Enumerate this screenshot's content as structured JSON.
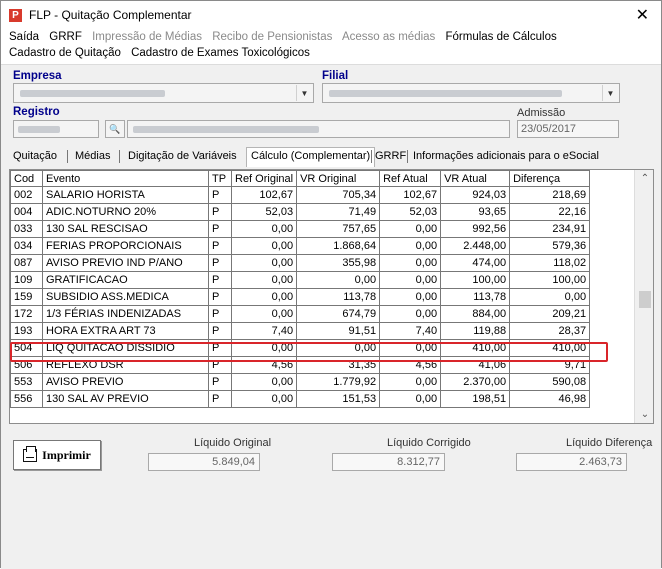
{
  "window": {
    "title": "FLP - Quitação Complementar",
    "icon": "app-icon"
  },
  "menu": {
    "row1": [
      {
        "label": "Saída",
        "disabled": false
      },
      {
        "label": "GRRF",
        "disabled": false
      },
      {
        "label": "Impressão de Médias",
        "disabled": true
      },
      {
        "label": "Recibo de Pensionistas",
        "disabled": true
      },
      {
        "label": "Acesso as médias",
        "disabled": true
      },
      {
        "label": "Fórmulas de Cálculos",
        "disabled": false
      }
    ],
    "row2": [
      {
        "label": "Cadastro de Quitação",
        "disabled": false
      },
      {
        "label": "Cadastro de Exames Toxicológicos",
        "disabled": false
      }
    ]
  },
  "fields": {
    "empresa_label": "Empresa",
    "filial_label": "Filial",
    "registro_label": "Registro",
    "admissao_label": "Admissão",
    "admissao_value": "23/05/2017"
  },
  "tabs": [
    "Quitação",
    "Médias",
    "Digitação de Variáveis",
    "Cálculo (Complementar)",
    "GRRF",
    "Informações adicionais para o eSocial"
  ],
  "table": {
    "headers": [
      "Cod",
      "Evento",
      "TP",
      "Ref Original",
      "VR Original",
      "Ref Atual",
      "VR Atual",
      "Diferença"
    ],
    "rows": [
      [
        "002",
        "SALARIO HORISTA",
        "P",
        "102,67",
        "705,34",
        "102,67",
        "924,03",
        "218,69"
      ],
      [
        "004",
        "ADIC.NOTURNO  20%",
        "P",
        "52,03",
        "71,49",
        "52,03",
        "93,65",
        "22,16"
      ],
      [
        "033",
        "130 SAL RESCISAO",
        "P",
        "0,00",
        "757,65",
        "0,00",
        "992,56",
        "234,91"
      ],
      [
        "034",
        "FERIAS PROPORCIONAIS",
        "P",
        "0,00",
        "1.868,64",
        "0,00",
        "2.448,00",
        "579,36"
      ],
      [
        "087",
        "AVISO PREVIO IND P/ANO",
        "P",
        "0,00",
        "355,98",
        "0,00",
        "474,00",
        "118,02"
      ],
      [
        "109",
        "GRATIFICACAO",
        "P",
        "0,00",
        "0,00",
        "0,00",
        "100,00",
        "100,00"
      ],
      [
        "159",
        "SUBSIDIO ASS.MEDICA",
        "P",
        "0,00",
        "113,78",
        "0,00",
        "113,78",
        "0,00"
      ],
      [
        "172",
        "1/3 FÉRIAS INDENIZADAS",
        "P",
        "0,00",
        "674,79",
        "0,00",
        "884,00",
        "209,21"
      ],
      [
        "193",
        "HORA EXTRA ART 73",
        "P",
        "7,40",
        "91,51",
        "7,40",
        "119,88",
        "28,37"
      ],
      [
        "504",
        "LIQ QUITACAO DISSIDIO",
        "P",
        "0,00",
        "0,00",
        "0,00",
        "410,00",
        "410,00"
      ],
      [
        "506",
        "REFLEXO DSR",
        "P",
        "4,56",
        "31,35",
        "4,56",
        "41,06",
        "9,71"
      ],
      [
        "553",
        "AVISO PREVIO",
        "P",
        "0,00",
        "1.779,92",
        "0,00",
        "2.370,00",
        "590,08"
      ],
      [
        "556",
        "130 SAL AV PREVIO",
        "P",
        "0,00",
        "151,53",
        "0,00",
        "198,51",
        "46,98"
      ]
    ],
    "highlighted_code": "504"
  },
  "actions": {
    "print_label": "Imprimir"
  },
  "totals": {
    "original_label": "Líquido Original",
    "original_value": "5.849,04",
    "corrigido_label": "Líquido Corrigido",
    "corrigido_value": "8.312,77",
    "diferenca_label": "Líquido Diferença",
    "diferenca_value": "2.463,73"
  },
  "colors": {
    "highlight": "#d9252a",
    "section_label": "#00008b"
  }
}
